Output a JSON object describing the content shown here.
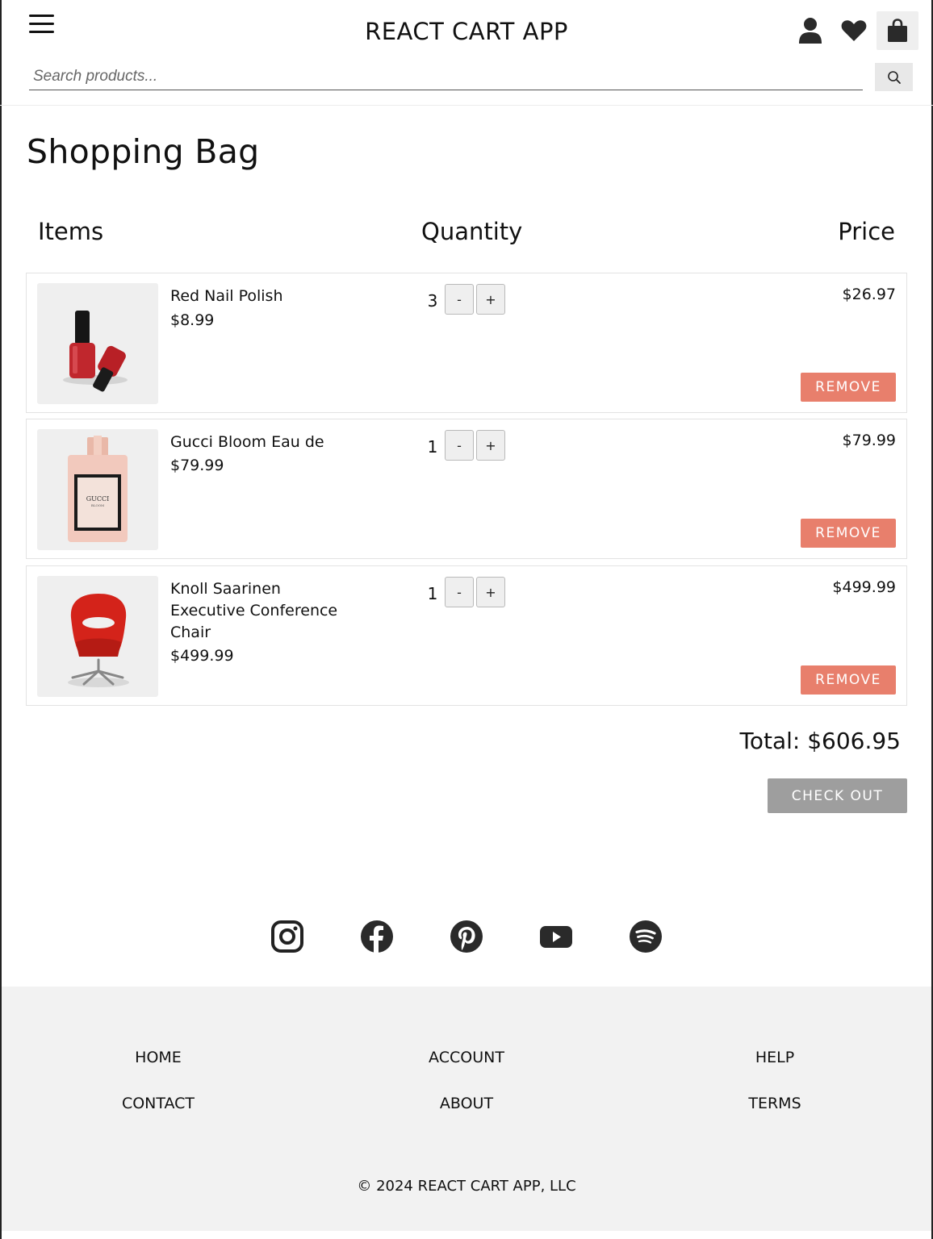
{
  "header": {
    "title": "REACT CART APP",
    "search_placeholder": "Search products..."
  },
  "icons": {
    "menu": "hamburger-menu-icon",
    "account": "user-icon",
    "wishlist": "heart-icon",
    "cart": "shopping-bag-icon",
    "search": "search-icon"
  },
  "page": {
    "title": "Shopping Bag",
    "columns": {
      "items": "Items",
      "quantity": "Quantity",
      "price": "Price"
    }
  },
  "cart": {
    "items": [
      {
        "name": "Red Nail Polish",
        "unit_price": "$8.99",
        "quantity": "3",
        "line_total": "$26.97",
        "remove_label": "REMOVE",
        "minus": "-",
        "plus": "+"
      },
      {
        "name": "Gucci Bloom Eau de",
        "unit_price": "$79.99",
        "quantity": "1",
        "line_total": "$79.99",
        "remove_label": "REMOVE",
        "minus": "-",
        "plus": "+"
      },
      {
        "name": "Knoll Saarinen Executive Conference Chair",
        "unit_price": "$499.99",
        "quantity": "1",
        "line_total": "$499.99",
        "remove_label": "REMOVE",
        "minus": "-",
        "plus": "+"
      }
    ],
    "total": "Total: $606.95",
    "checkout_label": "CHECK OUT"
  },
  "social": [
    "instagram-icon",
    "facebook-icon",
    "pinterest-icon",
    "youtube-icon",
    "spotify-icon"
  ],
  "footer": {
    "links": {
      "home": "HOME",
      "account": "ACCOUNT",
      "help": "HELP",
      "contact": "CONTACT",
      "about": "ABOUT",
      "terms": "TERMS"
    },
    "copyright": "© 2024 REACT CART APP, LLC"
  },
  "colors": {
    "remove_button": "#e87f6c",
    "checkout_button": "#9e9e9e",
    "footer_bg": "#f2f2f2"
  }
}
